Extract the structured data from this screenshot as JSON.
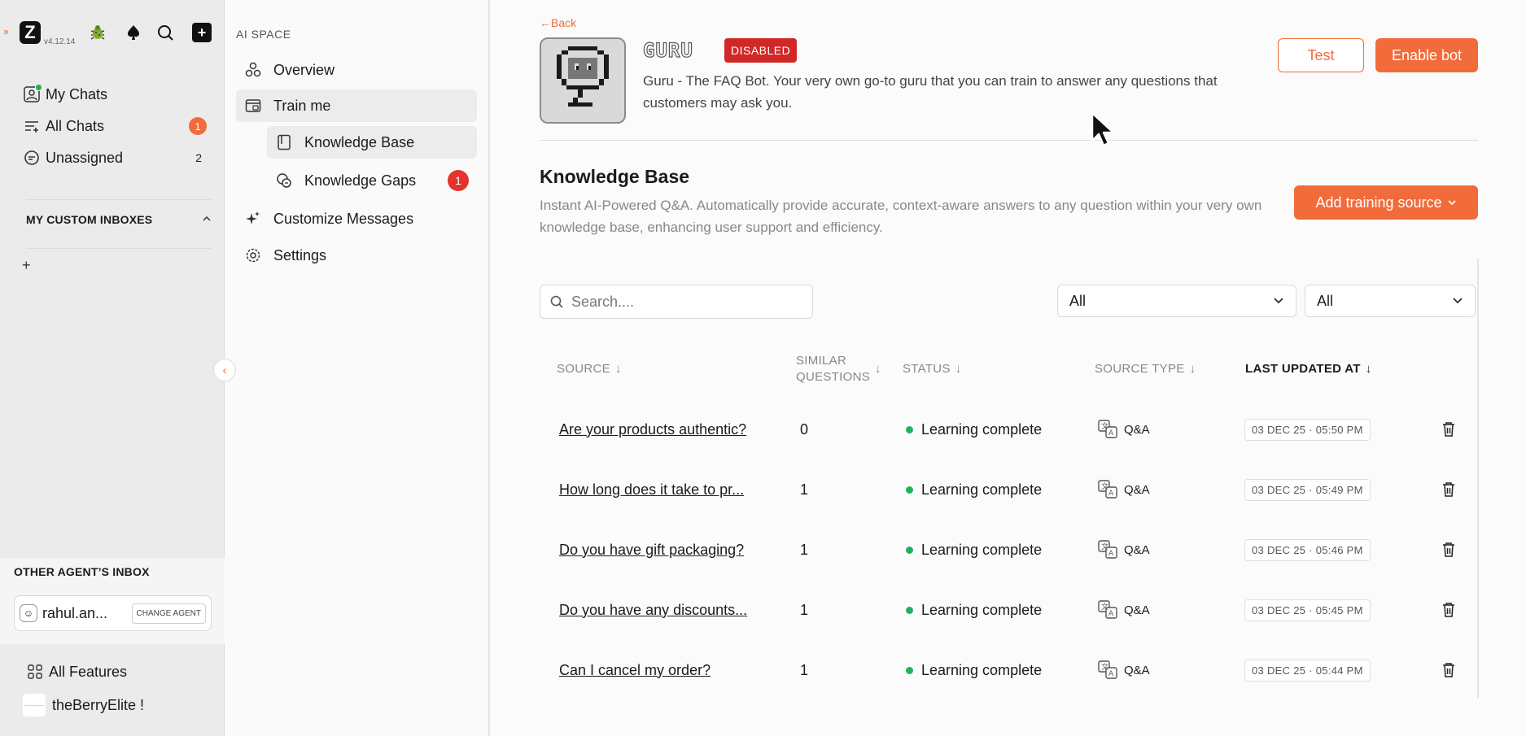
{
  "rail": {
    "version": "v4.12.14",
    "items": [
      {
        "label": "My Chats",
        "count": ""
      },
      {
        "label": "All Chats",
        "count": "1"
      },
      {
        "label": "Unassigned",
        "count": "2"
      }
    ],
    "custom_inboxes_title": "MY CUSTOM INBOXES",
    "other_inbox_title": "OTHER AGENT’S INBOX",
    "agent_name": "rahul.an...",
    "change_agent_label": "CHANGE AGENT",
    "all_features_label": "All Features",
    "workspace_name": "theBerryElite !"
  },
  "subnav": {
    "title": "AI SPACE",
    "items": [
      {
        "label": "Overview"
      },
      {
        "label": "Train me"
      },
      {
        "label": "Knowledge Base"
      },
      {
        "label": "Knowledge Gaps",
        "badge": "1"
      },
      {
        "label": "Customize Messages"
      },
      {
        "label": "Settings"
      }
    ]
  },
  "header": {
    "back_label": "Back",
    "bot_name": "GURU",
    "status_tag": "DISABLED",
    "description": "Guru - The FAQ Bot. Your very own go-to guru that you can train to answer any questions that customers may ask you.",
    "test_label": "Test",
    "enable_label": "Enable bot"
  },
  "knowledge_base": {
    "title": "Knowledge Base",
    "description": "Instant AI-Powered Q&A. Automatically provide accurate, context-aware answers to any question within your very own knowledge base, enhancing user support and efficiency.",
    "add_source_label": "Add training source",
    "search_placeholder": "Search....",
    "filter1_value": "All",
    "filter2_value": "All",
    "columns": {
      "source": "SOURCE",
      "similar_line1": "SIMILAR",
      "similar_line2": "QUESTIONS",
      "status": "STATUS",
      "source_type": "SOURCE TYPE",
      "last_updated": "LAST UPDATED AT"
    },
    "rows": [
      {
        "source": "Are your products authentic?",
        "similar": "0",
        "status": "Learning complete",
        "type": "Q&A",
        "updated": "03 DEC 25 · 05:50 PM"
      },
      {
        "source": "How long does it take to pr...",
        "similar": "1",
        "status": "Learning complete",
        "type": "Q&A",
        "updated": "03 DEC 25 · 05:49 PM"
      },
      {
        "source": "Do you have gift packaging?",
        "similar": "1",
        "status": "Learning complete",
        "type": "Q&A",
        "updated": "03 DEC 25 · 05:46 PM"
      },
      {
        "source": "Do you have any discounts...",
        "similar": "1",
        "status": "Learning complete",
        "type": "Q&A",
        "updated": "03 DEC 25 · 05:45 PM"
      },
      {
        "source": "Can I cancel my order?",
        "similar": "1",
        "status": "Learning complete",
        "type": "Q&A",
        "updated": "03 DEC 25 · 05:44 PM"
      }
    ]
  },
  "colors": {
    "accent": "#f26b3a",
    "danger": "#d12727",
    "success": "#1fb35a"
  }
}
